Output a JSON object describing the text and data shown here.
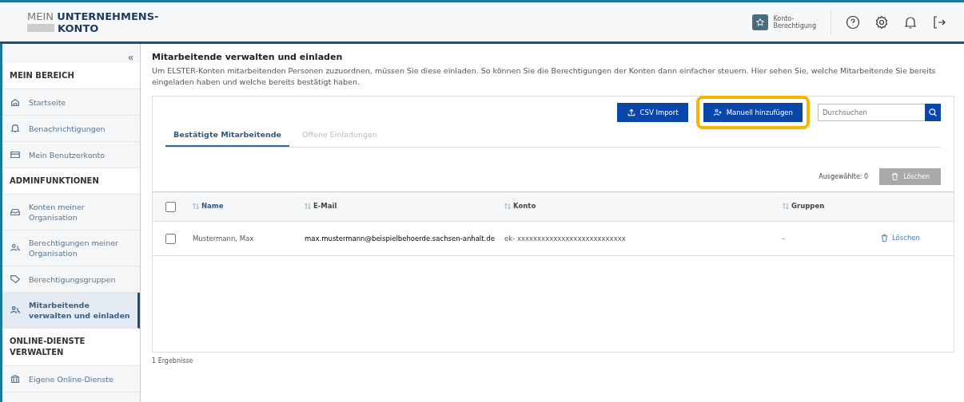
{
  "header": {
    "logo_light": "MEIN",
    "logo_bold_1": "UNTERNEHMENS-",
    "logo_bold_2": "KONTO",
    "account_badge": "Konto-\nBerechtigung"
  },
  "sidebar": {
    "collapse": "«",
    "items": [
      {
        "kind": "section",
        "label": "MEIN BEREICH"
      },
      {
        "kind": "link",
        "label": "Startseite",
        "selected": false
      },
      {
        "kind": "link",
        "label": "Benachrichtigungen",
        "selected": false
      },
      {
        "kind": "link",
        "label": "Mein Benutzerkonto",
        "selected": false
      },
      {
        "kind": "section",
        "label": "ADMINFUNKTIONEN"
      },
      {
        "kind": "link",
        "label": "Konten meiner Organisation",
        "selected": false
      },
      {
        "kind": "link",
        "label": "Berechtigungen meiner Organisation",
        "selected": false
      },
      {
        "kind": "link",
        "label": "Berechtigungsgruppen",
        "selected": false
      },
      {
        "kind": "link",
        "label": "Mitarbeitende verwalten und einladen",
        "selected": true
      },
      {
        "kind": "section",
        "label": "ONLINE-DIENSTE VERWALTEN"
      },
      {
        "kind": "link",
        "label": "Eigene Online-Dienste",
        "selected": false
      }
    ]
  },
  "page": {
    "title": "Mitarbeitende verwalten und einladen",
    "intro": "Um ELSTER-Konten mitarbeitenden Personen zuzuordnen, müssen Sie diese einladen. So können Sie die Berechtigungen der Konten dann einfacher steuern. Hier sehen Sie, welche Mitarbeitende Sie bereits eingeladen haben und welche bereits bestätigt haben."
  },
  "toolbar": {
    "buttons": [
      {
        "label": "CSV Import",
        "highlighted": false
      },
      {
        "label": "Manuell hinzufügen",
        "highlighted": true
      }
    ],
    "search": {
      "placeholder": "Durchsuchen"
    }
  },
  "tabs": [
    {
      "label": "Bestätigte Mitarbeitende",
      "selected": true
    },
    {
      "label": "Offene Einladungen",
      "selected": false
    }
  ],
  "selection": {
    "count_label": "Ausgewählte: 0",
    "delete": {
      "label": "Löschen",
      "disabled": true
    }
  },
  "table": {
    "select_all_checked": false,
    "columns": [
      "Name",
      "E-Mail",
      "Konto",
      "Gruppen"
    ],
    "rows": [
      {
        "checked": false,
        "name": "Mustermann, Max",
        "email": "max.mustermann@beispielbehoerde.sachsen-anhalt.de",
        "konto": "ek- xxxxxxxxxxxxxxxxxxxxxxxxxxx",
        "gruppen": "-",
        "action": "Löschen"
      }
    ]
  },
  "results": "1 Ergebnisse"
}
